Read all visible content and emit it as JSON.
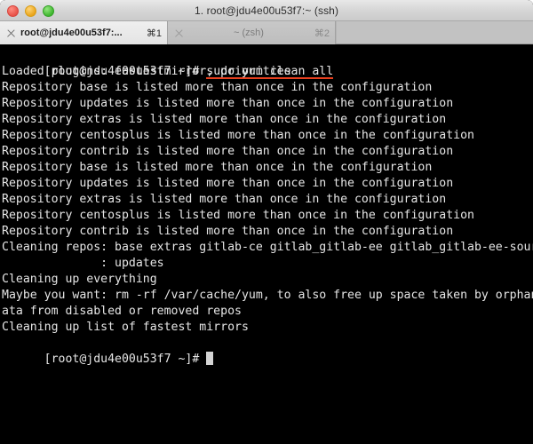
{
  "window": {
    "title": "1. root@jdu4e00u53f7:~ (ssh)",
    "traffic_lights": {
      "close_label": "close",
      "minimize_label": "minimize",
      "maximize_label": "maximize"
    },
    "colors": {
      "close": "#e8534a",
      "minimize": "#e9a51b",
      "maximize": "#3fb62f",
      "titlebar_bg": "#d6d6d6",
      "tabbar_bg": "#c2c2c2",
      "terminal_bg": "#000000",
      "terminal_fg": "#e6e6e6",
      "annotation_underline": "#e8401f"
    }
  },
  "tabs": [
    {
      "title": "root@jdu4e00u53f7:...",
      "shortcut": "⌘1",
      "active": true,
      "close_icon": "close-icon"
    },
    {
      "title": "~ (zsh)",
      "shortcut": "⌘2",
      "active": false,
      "close_icon": "close-icon"
    }
  ],
  "terminal": {
    "prompt": "[root@jdu4e00u53f7 ~]# ",
    "command": "sudo yum clean all",
    "lines": [
      "Loaded plugins: fastestmirror, priorities",
      "Repository base is listed more than once in the configuration",
      "Repository updates is listed more than once in the configuration",
      "Repository extras is listed more than once in the configuration",
      "Repository centosplus is listed more than once in the configuration",
      "Repository contrib is listed more than once in the configuration",
      "Repository base is listed more than once in the configuration",
      "Repository updates is listed more than once in the configuration",
      "Repository extras is listed more than once in the configuration",
      "Repository centosplus is listed more than once in the configuration",
      "Repository contrib is listed more than once in the configuration",
      "Cleaning repos: base extras gitlab-ce gitlab_gitlab-ee gitlab_gitlab-ee-source",
      "              : updates",
      "Cleaning up everything",
      "Maybe you want: rm -rf /var/cache/yum, to also free up space taken by orphaned d",
      "ata from disabled or removed repos",
      "Cleaning up list of fastest mirrors"
    ],
    "final_prompt": "[root@jdu4e00u53f7 ~]# ",
    "cursor": "block-cursor"
  }
}
